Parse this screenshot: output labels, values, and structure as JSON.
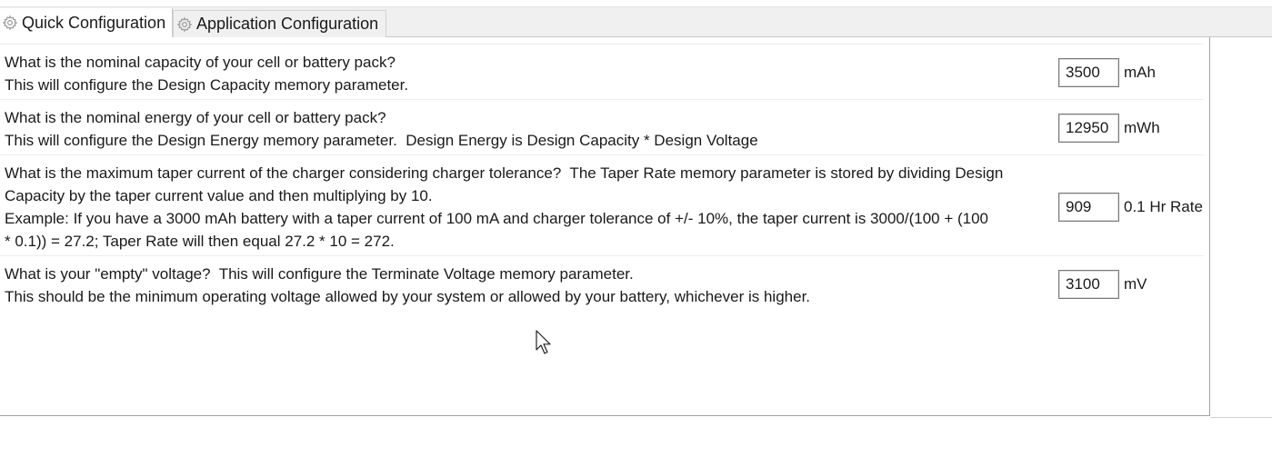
{
  "tabs": [
    {
      "label": "Quick Configuration",
      "icon": "gear-icon",
      "active": true
    },
    {
      "label": "Application Configuration",
      "icon": "gear-icon",
      "active": false
    }
  ],
  "questions": [
    {
      "lines": [
        "What is the nominal capacity of your cell or battery pack?",
        "This will configure the Design Capacity memory parameter."
      ],
      "value": "3500",
      "unit": "mAh"
    },
    {
      "lines": [
        "What is the nominal energy of your cell or battery pack?",
        "This will configure the Design Energy memory parameter.  Design Energy is Design Capacity * Design Voltage"
      ],
      "value": "12950",
      "unit": "mWh"
    },
    {
      "lines": [
        "What is the maximum taper current of the charger considering charger tolerance?  The Taper Rate memory parameter is stored by dividing Design",
        "Capacity by the taper current value and then multiplying by 10.",
        "Example: If you have a 3000 mAh battery with a taper current of 100 mA and charger tolerance of +/- 10%, the taper current is 3000/(100 + (100",
        "* 0.1)) = 27.2; Taper Rate will then equal 27.2 * 10 = 272."
      ],
      "value": "909",
      "unit": "0.1 Hr Rate"
    },
    {
      "lines": [
        "What is your \"empty\" voltage?  This will configure the Terminate Voltage memory parameter.",
        "This should be the minimum operating voltage allowed by your system or allowed by your battery, whichever is higher."
      ],
      "value": "3100",
      "unit": "mV"
    }
  ],
  "colors": {
    "tab_strip_bg": "#f0f0f0",
    "panel_bg": "#ffffff",
    "text": "#1a1a1a",
    "border": "#a0a0a0"
  }
}
